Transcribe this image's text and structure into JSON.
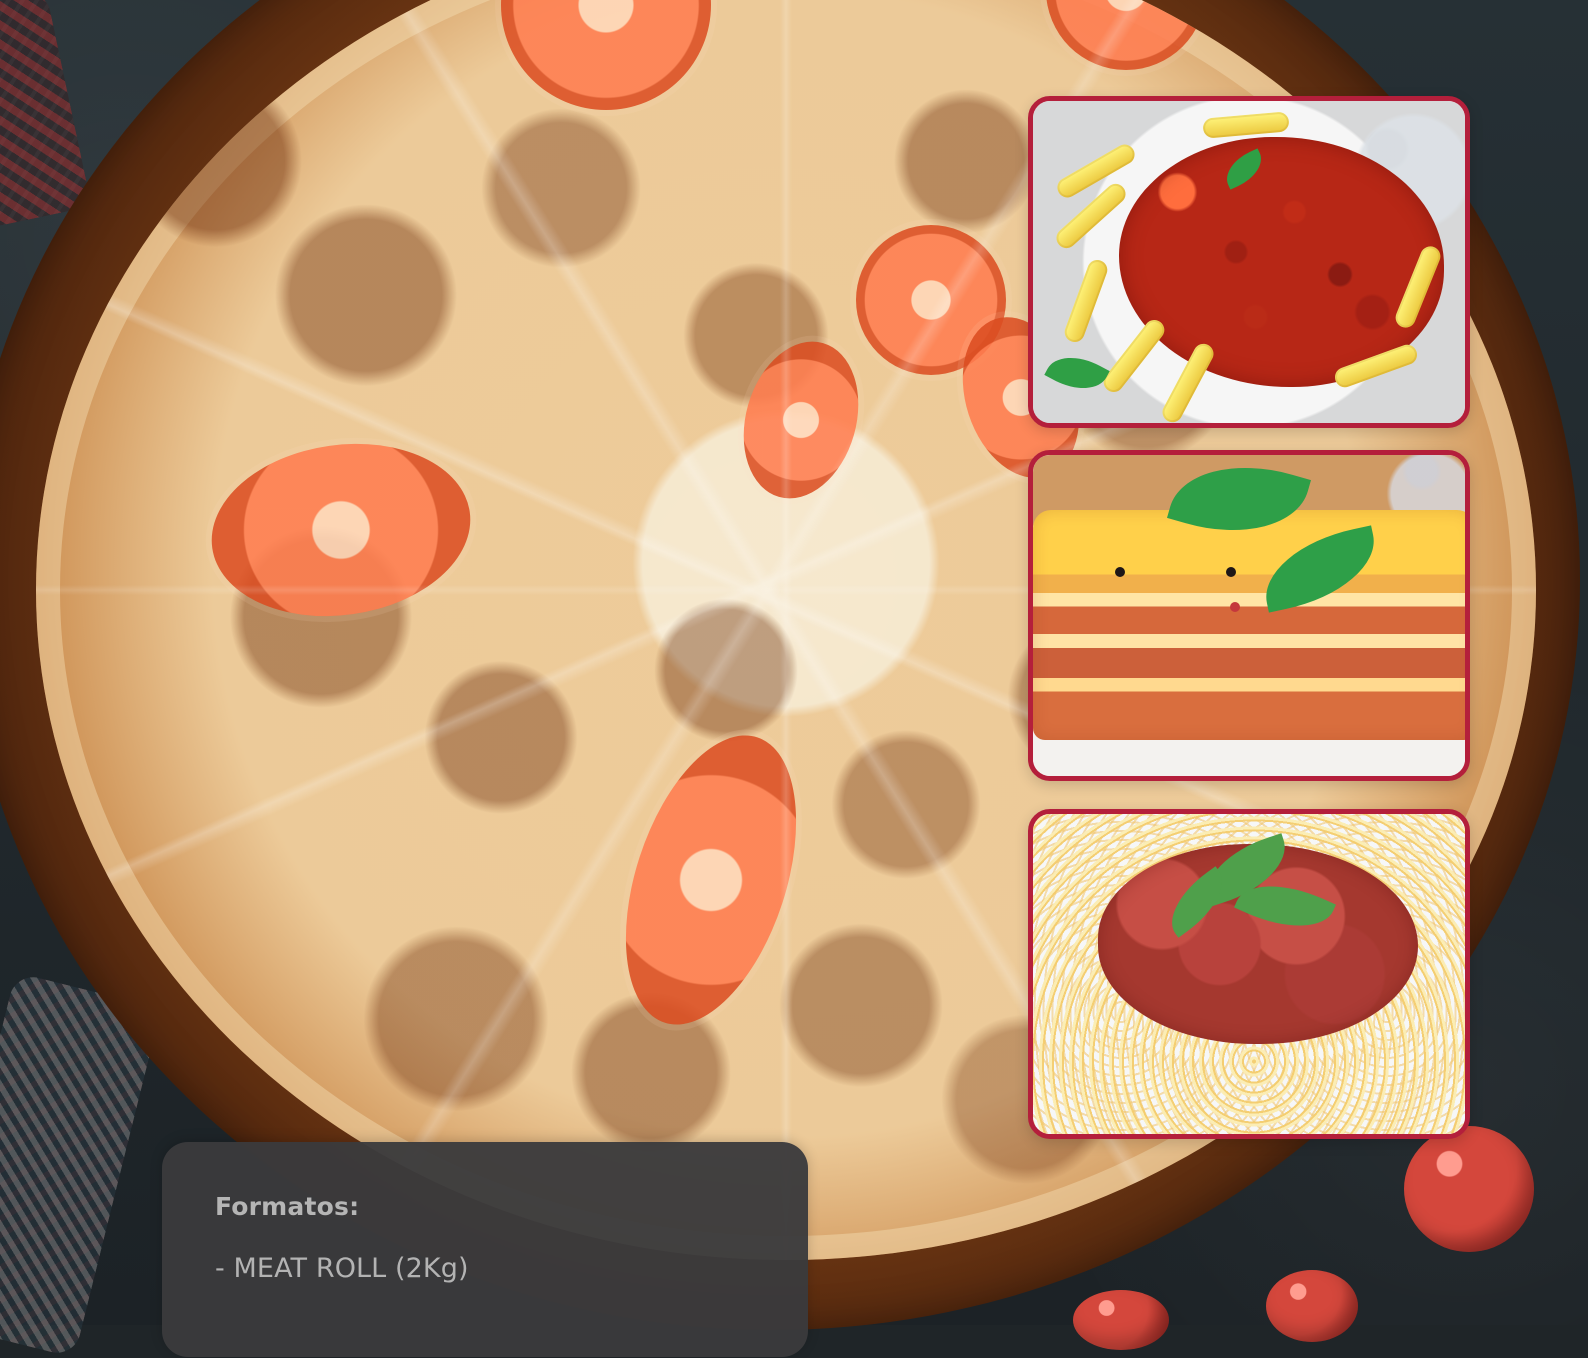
{
  "info_panel": {
    "title": "Formatos:",
    "items": [
      "- MEAT ROLL (2Kg)"
    ]
  },
  "colors": {
    "card_border": "#b41f3b",
    "panel_bg": "#3a3a3c",
    "panel_text": "#b3b3b3"
  },
  "images": [
    "penne-bolognese-photo",
    "lasagna-photo",
    "spaghetti-meatballs-photo"
  ]
}
